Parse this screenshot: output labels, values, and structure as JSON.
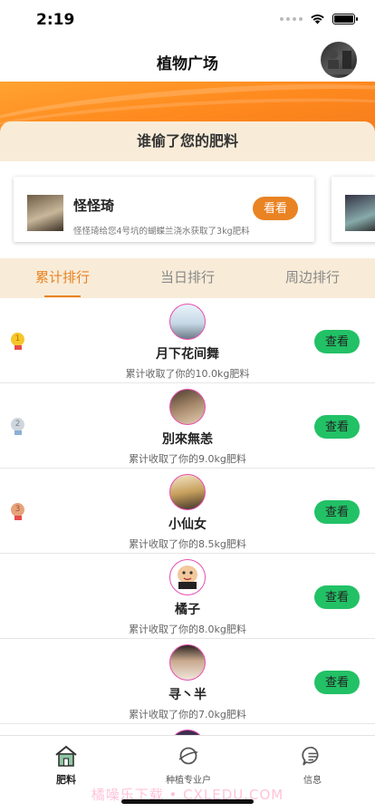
{
  "status": {
    "time": "2:19"
  },
  "header": {
    "title": "植物广场"
  },
  "thief": {
    "title": "谁偷了您的肥料",
    "card": {
      "name": "怪怪琦",
      "desc": "怪怪琦给您4号坑的蝴蝶兰浇水获取了3kg肥料",
      "button": "看看"
    }
  },
  "tabs": [
    {
      "label": "累计排行"
    },
    {
      "label": "当日排行"
    },
    {
      "label": "周边排行"
    }
  ],
  "ranking": [
    {
      "rank": "1",
      "name": "月下花间舞",
      "desc": "累计收取了你的10.0kg肥料",
      "button": "查看"
    },
    {
      "rank": "2",
      "name": "別來無恙",
      "desc": "累计收取了你的9.0kg肥料",
      "button": "查看"
    },
    {
      "rank": "3",
      "name": "小仙女",
      "desc": "累计收取了你的8.5kg肥料",
      "button": "查看"
    },
    {
      "rank": "",
      "name": "橘子",
      "desc": "累计收取了你的8.0kg肥料",
      "button": "查看"
    },
    {
      "rank": "",
      "name": "寻丶半",
      "desc": "累计收取了你的7.0kg肥料",
      "button": "查看"
    }
  ],
  "tabbar": [
    {
      "label": "肥料"
    },
    {
      "label": "种植专业户"
    },
    {
      "label": "信息"
    }
  ],
  "watermark": "橘噪乐下载 • CXLEDU.COM",
  "colors": {
    "accent": "#e98324",
    "tab_bg": "#f8ecd8",
    "view_green": "#22c166",
    "avatar_ring": "#e64fb0"
  },
  "icons": {
    "medals": [
      "gold-medal-icon",
      "silver-medal-icon",
      "bronze-medal-icon"
    ],
    "tabbar": [
      "home-icon",
      "planet-icon",
      "message-icon"
    ]
  }
}
